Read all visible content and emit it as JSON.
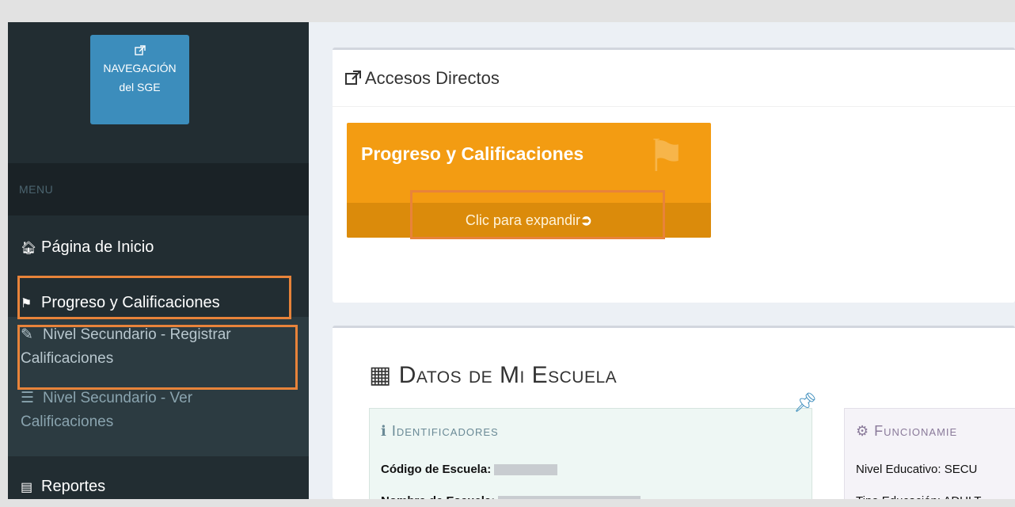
{
  "sidebar": {
    "nav_box": {
      "line1": "NAVEGACIÓN",
      "line2": "del SGE",
      "icon": "external-link-icon"
    },
    "menu_header": "MENU",
    "items": [
      {
        "label": "Página de Inicio",
        "icon": "home-icon"
      },
      {
        "label": "Progreso y Calificaciones",
        "icon": "flag-icon"
      },
      {
        "label": "Nivel Secundario - Registrar Calificaciones",
        "icon": "edit-icon"
      },
      {
        "label": "Nivel Secundario - Ver Calificaciones",
        "icon": "list-icon"
      },
      {
        "label": "Reportes",
        "icon": "file-text-icon"
      }
    ],
    "sub1_line1": "Nivel Secundario - Registrar",
    "sub1_line2": "Calificaciones",
    "sub2_line1": "Nivel Secundario - Ver",
    "sub2_line2": "Calificaciones"
  },
  "accesos": {
    "title": "Accesos Directos",
    "tile": {
      "title": "Progreso y Calificaciones",
      "footer": "Clic para expandir"
    }
  },
  "escuela": {
    "title": "Datos de Mi Escuela",
    "identificadores": {
      "title": "Identificadores",
      "codigo_label": "Código de Escuela:",
      "nombre_label": "Nombre de Escuela:"
    },
    "funcionamiento": {
      "title": "Funcionamie",
      "nivel": "Nivel Educativo: SECU",
      "tipo": "Tipo Educación: ADULT"
    }
  },
  "colors": {
    "accent": "#3c8dbc",
    "tile": "#f39c12",
    "highlight": "#e8833a",
    "sidebar": "#222d32"
  }
}
